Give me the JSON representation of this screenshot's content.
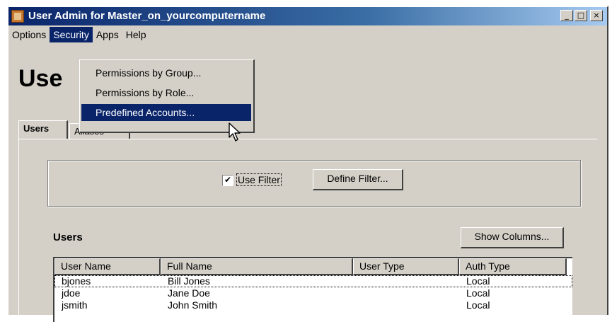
{
  "window": {
    "title": "User Admin for Master_on_yourcomputername",
    "minimize": "_",
    "maximize": "□",
    "close": "×"
  },
  "menubar": {
    "items": [
      "Options",
      "Security",
      "Apps",
      "Help"
    ],
    "active": "Security"
  },
  "security_menu": {
    "items": [
      "Permissions by Group...",
      "Permissions by Role...",
      "Predefined Accounts..."
    ],
    "highlighted": "Predefined Accounts..."
  },
  "heading": "Use",
  "tabs": {
    "users": "Users",
    "aliases": "Aliases",
    "active": "Users"
  },
  "filter": {
    "use_filter_label": "Use Filter",
    "use_filter_checked": true,
    "checkmark": "✔",
    "define_filter_label": "Define Filter..."
  },
  "users_section": {
    "label": "Users",
    "show_columns_label": "Show Columns..."
  },
  "table": {
    "columns": [
      "User Name",
      "Full Name",
      "User Type",
      "Auth Type"
    ],
    "rows": [
      [
        "bjones",
        "Bill Jones",
        "",
        "Local"
      ],
      [
        "jdoe",
        "Jane Doe",
        "",
        "Local"
      ],
      [
        "jsmith",
        "John Smith",
        "",
        "Local"
      ]
    ]
  },
  "icons": {
    "app": "user-admin-icon",
    "cursor": "mouse-pointer-icon",
    "check": "checkmark-icon"
  },
  "colors": {
    "titlebar": "#0a246a",
    "menu_highlight": "#0a246a",
    "face": "#d4d0c8"
  }
}
